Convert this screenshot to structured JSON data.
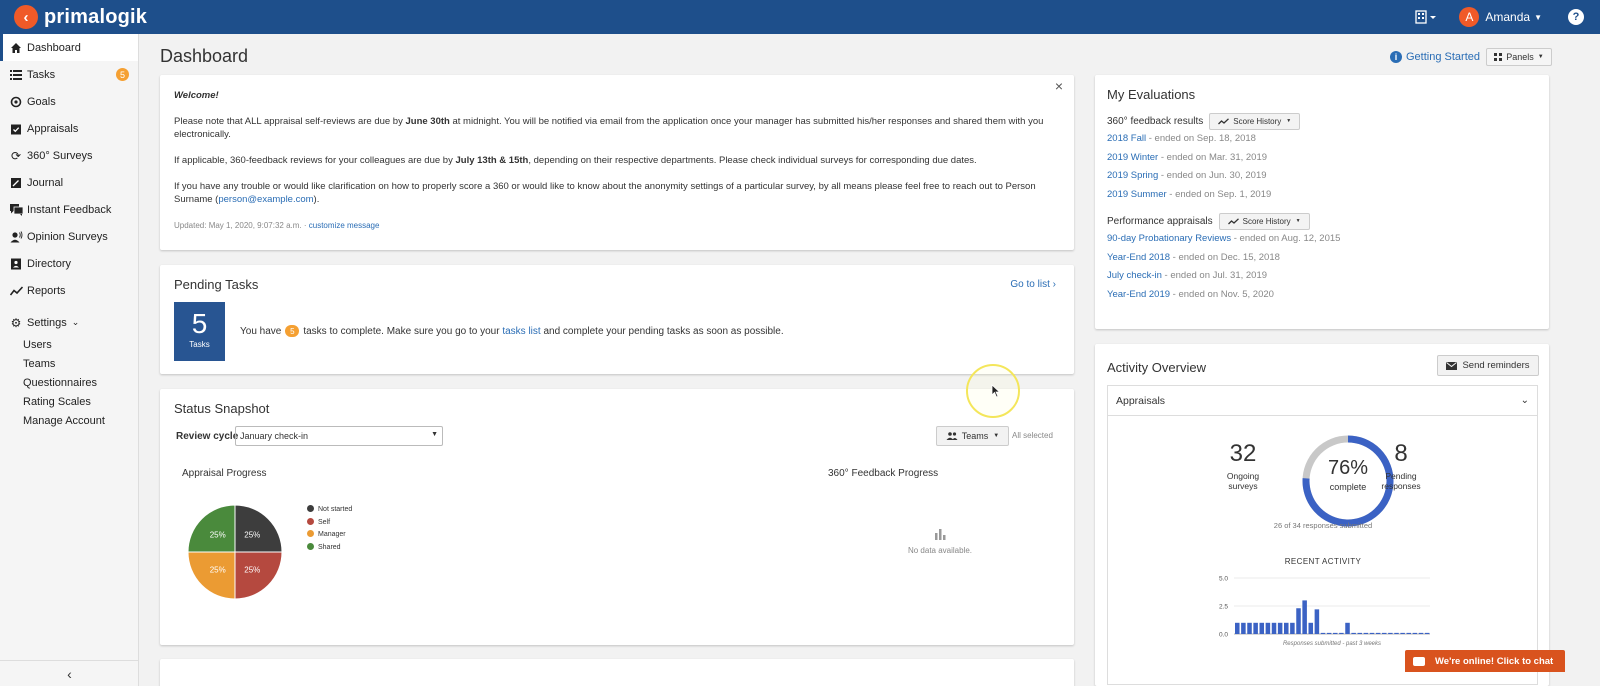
{
  "app": {
    "brand": "primalogik",
    "user_initial": "A",
    "user_name": "Amanda",
    "help": "?"
  },
  "sidebar": {
    "items": [
      {
        "label": "Dashboard",
        "icon": "home-icon"
      },
      {
        "label": "Tasks",
        "icon": "list-icon",
        "badge": "5"
      },
      {
        "label": "Goals",
        "icon": "target-icon"
      },
      {
        "label": "Appraisals",
        "icon": "clipboard-check-icon"
      },
      {
        "label": "360° Surveys",
        "icon": "sync-icon"
      },
      {
        "label": "Journal",
        "icon": "journal-icon"
      },
      {
        "label": "Instant Feedback",
        "icon": "chat-icon"
      },
      {
        "label": "Opinion Surveys",
        "icon": "person-voice-icon"
      },
      {
        "label": "Directory",
        "icon": "contact-book-icon"
      },
      {
        "label": "Reports",
        "icon": "trend-icon"
      },
      {
        "label": "Settings",
        "icon": "gear-icon"
      }
    ],
    "settings_sub": [
      "Users",
      "Teams",
      "Questionnaires",
      "Rating Scales",
      "Manage Account"
    ],
    "collapse": "‹"
  },
  "header": {
    "title": "Dashboard",
    "getting_started": "Getting Started",
    "panels": "Panels"
  },
  "welcome": {
    "heading": "Welcome!",
    "p1_a": "Please note that ALL appraisal self-reviews are due by ",
    "p1_b": "June 30th",
    "p1_c": " at midnight. You will be notified via email from the application once your manager has submitted his/her responses and shared them with you electronically.",
    "p2_a": "If applicable, 360-feedback reviews for your colleagues are due by ",
    "p2_b": "July 13th & 15th",
    "p2_c": ", depending on their respective departments. Please check individual surveys for corresponding due dates.",
    "p3_a": "If you have any trouble or would like clarification on how to properly score a 360 or would like to know about the anonymity settings of a particular survey, by all means please feel free to reach out to Person Surname (",
    "p3_link": "person@example.com",
    "p3_c": ").",
    "updated": "Updated: May 1, 2020, 9:07:32 a.m. · ",
    "customize": "customize message",
    "close": "×"
  },
  "pending": {
    "title": "Pending Tasks",
    "goto": "Go to list",
    "count": "5",
    "count_label": "Tasks",
    "text_a": "You have",
    "badge": "5",
    "text_b": "tasks to complete. Make sure you go to your",
    "link": "tasks list",
    "text_c": "and complete your pending tasks as soon as possible."
  },
  "status": {
    "title": "Status Snapshot",
    "cycle_label": "Review cycle",
    "cycle_value": "January check-in",
    "teams": "Teams",
    "all_selected": "All selected",
    "appraisal_title": "Appraisal Progress",
    "feedback_title": "360° Feedback Progress",
    "no_data": "No data available."
  },
  "chart_data": {
    "type": "pie",
    "title": "Appraisal Progress",
    "categories": [
      "Not started",
      "Self",
      "Manager",
      "Shared"
    ],
    "values": [
      25,
      25,
      25,
      25
    ],
    "labels": [
      "25%",
      "25%",
      "25%",
      "25%"
    ],
    "colors": [
      "#3d3d3d",
      "#b5493f",
      "#eb9b33",
      "#4a8a3c"
    ]
  },
  "evaluations": {
    "title": "My Evaluations",
    "feedback_label": "360° feedback results",
    "score_history": "Score History",
    "feedback": [
      {
        "name": "2018 Fall",
        "ended": " - ended on Sep. 18, 2018"
      },
      {
        "name": "2019 Winter",
        "ended": " - ended on Mar. 31, 2019"
      },
      {
        "name": "2019 Spring",
        "ended": " - ended on Jun. 30, 2019"
      },
      {
        "name": "2019 Summer",
        "ended": " - ended on Sep. 1, 2019"
      }
    ],
    "perf_label": "Performance appraisals",
    "perf": [
      {
        "name": "90-day Probationary Reviews",
        "ended": " - ended on Aug. 12, 2015"
      },
      {
        "name": "Year-End 2018",
        "ended": " - ended on Dec. 15, 2018"
      },
      {
        "name": "July check-in",
        "ended": " - ended on Jul. 31, 2019"
      },
      {
        "name": "Year-End 2019",
        "ended": " - ended on Nov. 5, 2020"
      }
    ]
  },
  "activity": {
    "title": "Activity Overview",
    "send": "Send reminders",
    "panel": "Appraisals",
    "ongoing": "32",
    "ongoing_label_1": "Ongoing",
    "ongoing_label_2": "surveys",
    "percent": "76%",
    "percent_label": "complete",
    "percent_value": 0.76,
    "pending": "8",
    "pending_label_1": "Pending",
    "pending_label_2": "responses",
    "submitted": "26 of 34 responses submitted",
    "recent_title": "RECENT ACTIVITY",
    "recent_chart": {
      "y_ticks": [
        "5.0",
        "2.5",
        "0.0"
      ],
      "values": [
        1,
        1,
        1,
        1,
        1,
        1,
        1,
        1,
        1,
        1,
        2.3,
        3,
        1,
        2.2,
        0.1,
        0.1,
        0.1,
        0.1,
        1,
        0.1,
        0.1,
        0.1,
        0.1,
        0.1,
        0.1,
        0.1,
        0.1,
        0.1,
        0.1,
        0.1,
        0.1,
        0.1
      ],
      "caption": "Responses submitted - past 3 weeks",
      "color": "#3b62c4"
    }
  },
  "chat": {
    "label": "We're online! Click to chat"
  }
}
